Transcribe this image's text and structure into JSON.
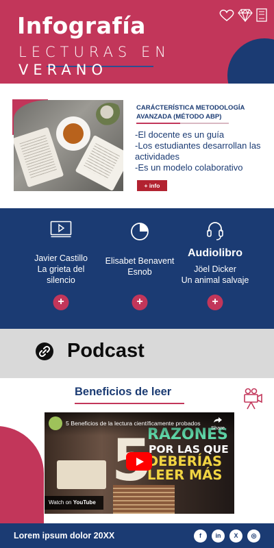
{
  "header": {
    "title": "Infografía",
    "subtitle_line1": "LECTURAS EN",
    "subtitle_line2": "VERANO",
    "icons": [
      "heart-icon",
      "diamond-icon",
      "book-icon"
    ]
  },
  "method": {
    "heading": "CARÁCTERÍSTICA METODOLOGÍA AVANZADA (MÉTODO ABP)",
    "bullets": [
      "-El docente es un guía",
      "-Los estudiantes desarrollan las actividades",
      "-Es un modelo colaborativo"
    ],
    "info_button": "+ info"
  },
  "books": [
    {
      "icon": "video-player-icon",
      "title": "",
      "line1": "Javier Castillo",
      "line2": "La grieta del",
      "line3": "silencio",
      "plus": "+"
    },
    {
      "icon": "pie-chart-icon",
      "title": "",
      "line1": "Elisabet Benavent",
      "line2": "Esnob",
      "line3": "",
      "plus": "+"
    },
    {
      "icon": "headphones-icon",
      "title": "Audiolibro",
      "line1": "Jöel Dicker",
      "line2": "Un animal salvaje",
      "line3": "",
      "plus": "+"
    }
  ],
  "podcast": {
    "label": "Podcast",
    "icon": "link-icon"
  },
  "benefits": {
    "title": "Beneficios de leer",
    "icon": "movie-camera-icon"
  },
  "video": {
    "title": "5 Beneficios de la lectura científicamente probados",
    "share_label": "Share",
    "big_number": "5",
    "line1": "RAZONES",
    "line2": "POR LAS QUE",
    "line3": "DEBERÍAS",
    "line4": "LEER MÁS",
    "watch_on": "Watch on",
    "platform": "YouTube"
  },
  "footer": {
    "text": "Lorem ipsum dolor 20XX",
    "social": [
      {
        "icon": "facebook-icon",
        "glyph": "f"
      },
      {
        "icon": "linkedin-icon",
        "glyph": "in"
      },
      {
        "icon": "x-icon",
        "glyph": "X"
      },
      {
        "icon": "instagram-icon",
        "glyph": "◎"
      }
    ]
  },
  "colors": {
    "primary_red": "#c2365a",
    "navy": "#1b3b73",
    "gray": "#d9d9d9",
    "button_red": "#b22230"
  }
}
